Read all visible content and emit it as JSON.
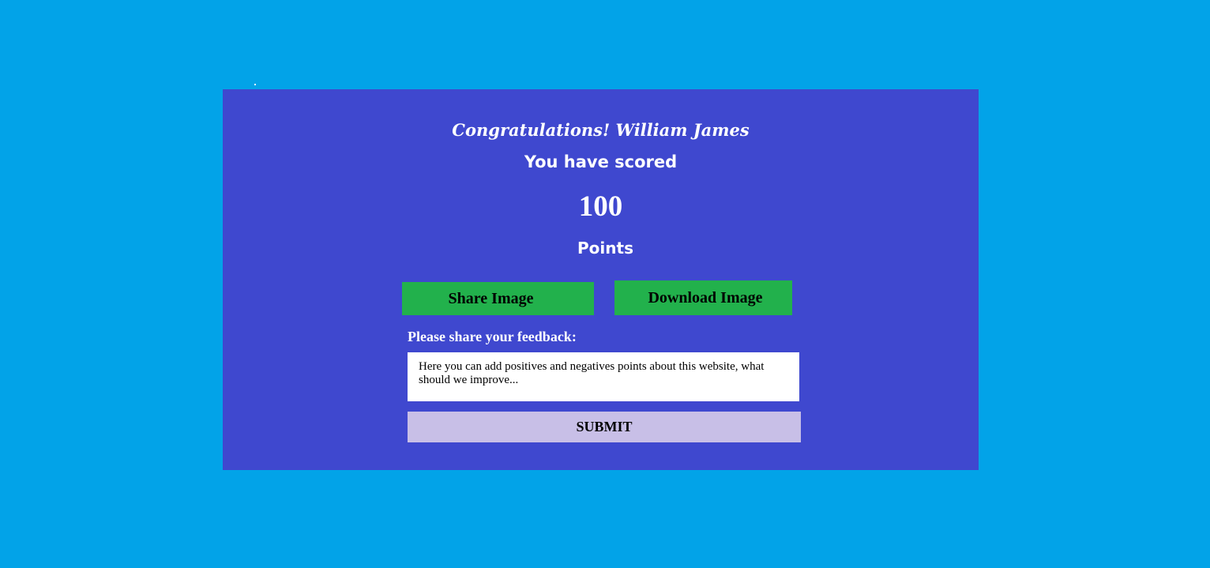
{
  "result": {
    "greeting": "Congratulations! William James",
    "scored_text": "You have scored",
    "score": "100",
    "points_label": "Points"
  },
  "actions": {
    "share_label": "Share Image",
    "download_label": "Download Image"
  },
  "feedback": {
    "label": "Please share your feedback:",
    "placeholder": "Here you can add positives and negatives points about this website, what should we improve...",
    "value": "",
    "submit_label": "SUBMIT"
  },
  "colors": {
    "page_background": "#02A3E8",
    "card_background": "#3F48CF",
    "action_button": "#22B14C",
    "submit_button": "#C8BFE7",
    "text_light": "#FFFFFF"
  }
}
